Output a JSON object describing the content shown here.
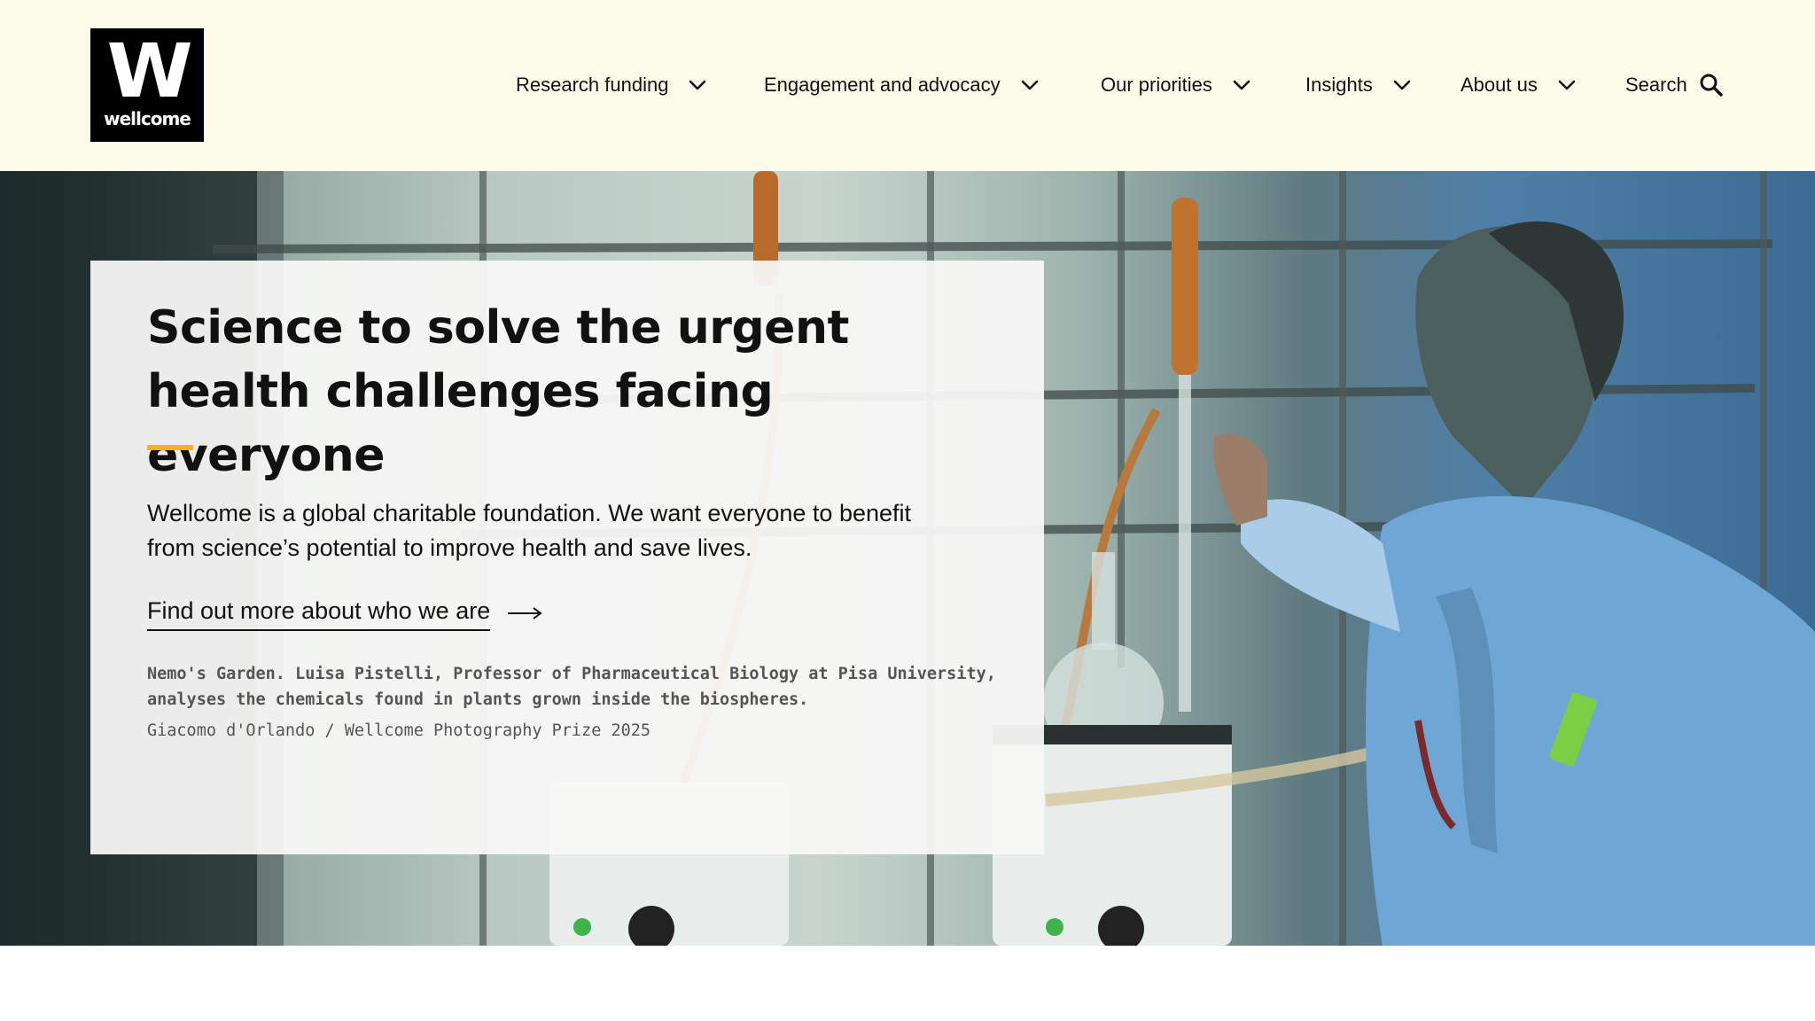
{
  "brand": {
    "logo_letter": "W",
    "logo_word": "wellcome",
    "colors": {
      "header_bg": "#fdfbe9",
      "logo_bg": "#000000",
      "accent": "#f2b51d"
    }
  },
  "nav": {
    "items": [
      {
        "label": "Research funding",
        "icon": "chevron-down-icon"
      },
      {
        "label": "Engagement and advocacy",
        "icon": "chevron-down-icon"
      },
      {
        "label": "Our priorities",
        "icon": "chevron-down-icon"
      },
      {
        "label": "Insights",
        "icon": "chevron-down-icon"
      },
      {
        "label": "About us",
        "icon": "chevron-down-icon"
      }
    ],
    "search": {
      "label": "Search",
      "icon": "search-icon"
    }
  },
  "hero": {
    "title": "Science to solve the urgent health challenges facing everyone",
    "description": "Wellcome is a global charitable foundation. We want everyone to benefit from science’s potential to improve health and save lives.",
    "link_label": "Find out more about who we are",
    "link_icon": "long-arrow-right-icon",
    "caption": "Nemo's Garden. Luisa Pistelli, Professor of Pharmaceutical Biology at Pisa University, analyses the chemicals found in plants grown inside the biospheres.",
    "credit": "Giacomo d'Orlando / Wellcome Photography Prize 2025"
  }
}
